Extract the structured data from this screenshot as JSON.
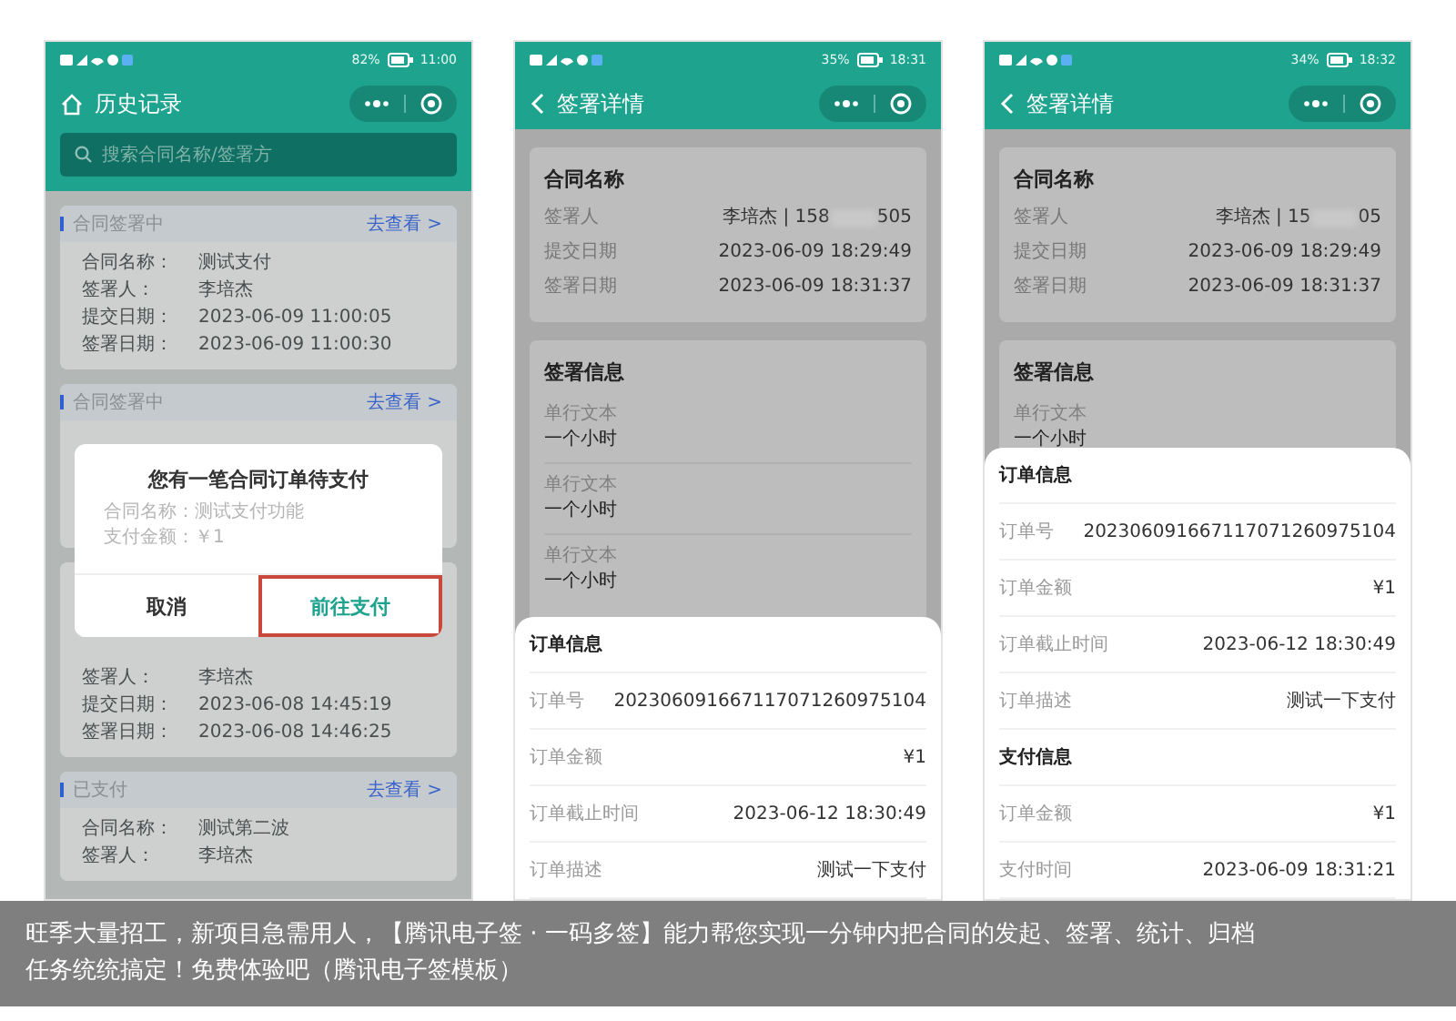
{
  "phones": [
    {
      "kind": "history",
      "status_bar": {
        "battery": "82%",
        "time": "11:00"
      },
      "title": "历史记录",
      "search": {
        "placeholder": "搜索合同名称/签署方"
      },
      "records": [
        {
          "status": "合同签署中",
          "link": "去查看 >",
          "fields": [
            {
              "label": "合同名称：",
              "value": "测试支付"
            },
            {
              "label": "签署人：",
              "value": "李培杰"
            },
            {
              "label": "提交日期：",
              "value": "2023-06-09 11:00:05"
            },
            {
              "label": "签署日期：",
              "value": "2023-06-09 11:00:30"
            }
          ]
        },
        {
          "status": "合同签署中",
          "link": "去查看 >"
        },
        {
          "fields": [
            {
              "label": "签署人：",
              "value": "李培杰"
            },
            {
              "label": "提交日期：",
              "value": "2023-06-08 14:45:19"
            },
            {
              "label": "签署日期：",
              "value": "2023-06-08 14:46:25"
            }
          ]
        },
        {
          "status": "已支付",
          "link": "去查看 >",
          "fields": [
            {
              "label": "合同名称：",
              "value": "测试第二波"
            },
            {
              "label": "签署人：",
              "value": "李培杰"
            }
          ]
        }
      ],
      "dialog": {
        "title": "您有一笔合同订单待支付",
        "lines": [
          "合同名称：测试支付功能",
          "支付金额：￥1"
        ],
        "buttons": [
          {
            "label": "取消",
            "highlighted": false
          },
          {
            "label": "前往支付",
            "highlighted": true
          }
        ]
      }
    },
    {
      "kind": "detail",
      "status_bar": {
        "battery": "35%",
        "time": "18:31"
      },
      "title": "签署详情",
      "contract": {
        "title": "合同名称",
        "rows": [
          {
            "label": "签署人",
            "value": "李培杰 | 158",
            "value_end": "505"
          },
          {
            "label": "提交日期",
            "value": "2023-06-09 18:29:49"
          },
          {
            "label": "签署日期",
            "value": "2023-06-09 18:31:37"
          }
        ]
      },
      "sign_info": {
        "title": "签署信息",
        "entries": [
          {
            "label": "单行文本",
            "value": "一个小时"
          },
          {
            "label": "单行文本",
            "value": "一个小时"
          },
          {
            "label": "单行文本",
            "value": "一个小时"
          }
        ]
      },
      "sheet": [
        {
          "title": "订单信息",
          "rows": [
            {
              "label": "订单号",
              "value": "202306091667117071260975104"
            },
            {
              "label": "订单金额",
              "value": "¥1"
            },
            {
              "label": "订单截止时间",
              "value": "2023-06-12 18:30:49"
            },
            {
              "label": "订单描述",
              "value": "测试一下支付"
            }
          ]
        }
      ]
    },
    {
      "kind": "detail",
      "status_bar": {
        "battery": "34%",
        "time": "18:32"
      },
      "title": "签署详情",
      "contract": {
        "title": "合同名称",
        "rows": [
          {
            "label": "签署人",
            "value": "李培杰 | 15",
            "value_end": "05"
          },
          {
            "label": "提交日期",
            "value": "2023-06-09 18:29:49"
          },
          {
            "label": "签署日期",
            "value": "2023-06-09 18:31:37"
          }
        ]
      },
      "sign_info": {
        "title": "签署信息",
        "entries": [
          {
            "label": "单行文本",
            "value": "一个小时"
          }
        ]
      },
      "sheet": [
        {
          "title": "订单信息",
          "rows": [
            {
              "label": "订单号",
              "value": "202306091667117071260975104"
            },
            {
              "label": "订单金额",
              "value": "¥1"
            },
            {
              "label": "订单截止时间",
              "value": "2023-06-12 18:30:49"
            },
            {
              "label": "订单描述",
              "value": "测试一下支付"
            }
          ]
        },
        {
          "title": "支付信息",
          "rows": [
            {
              "label": "订单金额",
              "value": "¥1"
            },
            {
              "label": "支付时间",
              "value": "2023-06-09 18:31:21"
            }
          ]
        }
      ]
    }
  ],
  "caption": [
    "旺季大量招工，新项目急需用人，【腾讯电子签 · 一码多签】能力帮您实现一分钟内把合同的发起、签署、统计、归档",
    "任务统统搞定！免费体验吧（腾讯电子签模板）"
  ]
}
